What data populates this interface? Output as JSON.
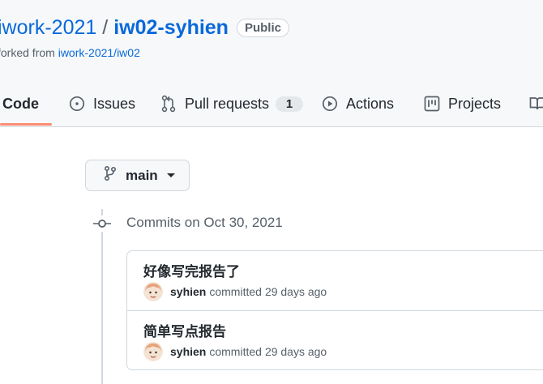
{
  "repo": {
    "owner": "iwork-2021",
    "separator": "/",
    "name": "iw02-syhien",
    "visibility": "Public",
    "fork_prefix": "forked from ",
    "fork_source": "iwork-2021/iw02"
  },
  "tabs": [
    {
      "label": "Code",
      "icon": "code-icon",
      "active": true
    },
    {
      "label": "Issues",
      "icon": "issue-opened-icon"
    },
    {
      "label": "Pull requests",
      "icon": "git-pull-request-icon",
      "count": "1"
    },
    {
      "label": "Actions",
      "icon": "play-icon"
    },
    {
      "label": "Projects",
      "icon": "project-icon"
    },
    {
      "label": "",
      "icon": "book-icon"
    }
  ],
  "branch": {
    "name": "main",
    "icon": "git-branch-icon"
  },
  "commits_group": {
    "date_label": "Commits on Oct 30, 2021"
  },
  "commits": [
    {
      "message": "好像写完报告了",
      "author": "syhien",
      "action": "committed",
      "time": "29 days ago"
    },
    {
      "message": "简单写点报告",
      "author": "syhien",
      "action": "committed",
      "time": "29 days ago"
    }
  ],
  "colors": {
    "link": "#0969da",
    "tab_underline": "#fd8c73",
    "border": "#d0d7de",
    "muted": "#57606a"
  }
}
